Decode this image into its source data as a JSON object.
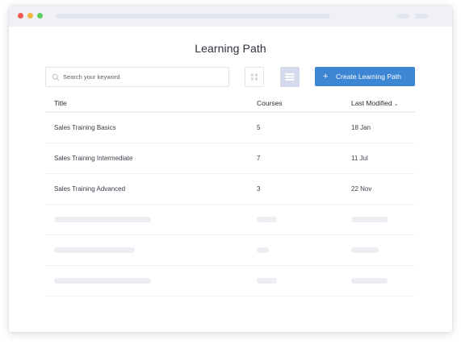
{
  "window": {
    "controls": [
      "close",
      "minimize",
      "maximize"
    ]
  },
  "page": {
    "title": "Learning Path"
  },
  "search": {
    "placeholder": "Search your keyword",
    "value": ""
  },
  "toolbar": {
    "view_options": [
      "grid",
      "list"
    ],
    "active_view": "list",
    "create_label": "Create Learning Path",
    "create_icon": "+"
  },
  "table": {
    "columns": {
      "title": "Title",
      "courses": "Courses",
      "modified": "Last Modified",
      "modified_sort_icon": "chevron-down-icon"
    },
    "rows": [
      {
        "title": "Sales Training Basics",
        "courses": "5",
        "modified": "18 Jan"
      },
      {
        "title": "Sales Training Intermediate",
        "courses": "7",
        "modified": "11 Jul"
      },
      {
        "title": "Sales Training Advanced",
        "courses": "3",
        "modified": "22 Nov"
      }
    ],
    "placeholder_rows": 3
  },
  "colors": {
    "accent": "#3d86d3",
    "active_view_bg": "#d4d9ec",
    "skeleton": "#eceef4",
    "titlebar": "#f0f1f6"
  }
}
